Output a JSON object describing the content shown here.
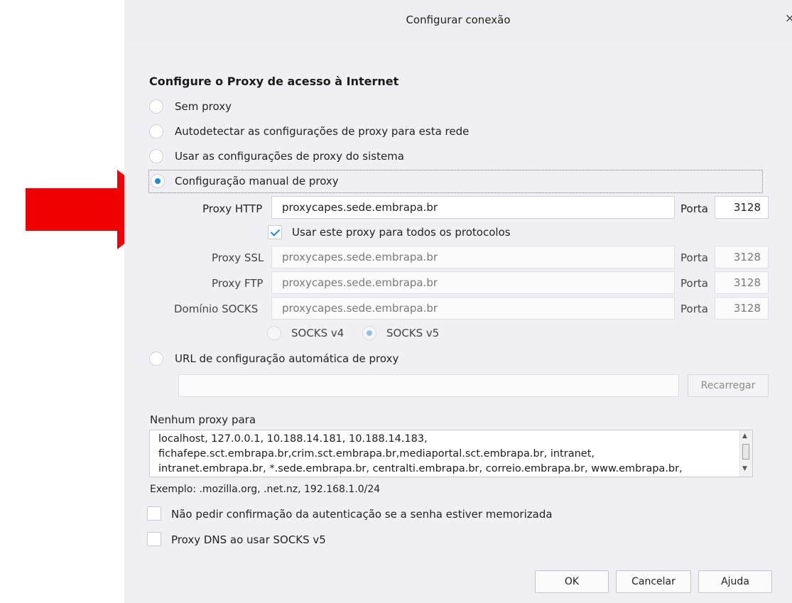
{
  "dialog": {
    "title": "Configurar conexão",
    "close_glyph": "×",
    "heading": "Configure o Proxy de acesso à Internet",
    "options": {
      "no_proxy": "Sem proxy",
      "auto_detect": "Autodetectar as configurações de proxy para esta rede",
      "system": "Usar as configurações de proxy do sistema",
      "manual": "Configuração manual de proxy",
      "pac": "URL de configuração automática de proxy"
    },
    "selected_option": "manual",
    "http": {
      "label": "Proxy HTTP",
      "value": "proxycapes.sede.embrapa.br",
      "port_label": "Porta",
      "port": "3128"
    },
    "use_for_all": {
      "label": "Usar este proxy para todos os protocolos",
      "checked": true
    },
    "ssl": {
      "label": "Proxy SSL",
      "value": "proxycapes.sede.embrapa.br",
      "port_label": "Porta",
      "port": "3128"
    },
    "ftp": {
      "label": "Proxy FTP",
      "value": "proxycapes.sede.embrapa.br",
      "port_label": "Porta",
      "port": "3128"
    },
    "socks": {
      "label": "Domínio SOCKS",
      "value": "proxycapes.sede.embrapa.br",
      "port_label": "Porta",
      "port": "3128"
    },
    "socks_v4": "SOCKS v4",
    "socks_v5": "SOCKS v5",
    "socks_selected": "v5",
    "pac_url": {
      "value": "",
      "reload_label": "Recarregar"
    },
    "no_proxy_for": {
      "label": "Nenhum proxy para",
      "lines": [
        "localhost, 127.0.0.1, 10.188.14.181, 10.188.14.183,",
        "fichafepe.sct.embrapa.br,crim.sct.embrapa.br,mediaportal.sct.embrapa.br, intranet,",
        "intranet.embrapa.br, *.sede.embrapa.br, centralti.embrapa.br, correio.embrapa.br, www.embrapa.br,"
      ],
      "example": "Exemplo: .mozilla.org, .net.nz, 192.168.1.0/24"
    },
    "no_auth_prompt": {
      "label": "Não pedir confirmação da autenticação se a senha estiver memorizada",
      "checked": false
    },
    "proxy_dns": {
      "label": "Proxy DNS ao usar SOCKS v5",
      "checked": false
    },
    "buttons": {
      "ok": "OK",
      "cancel": "Cancelar",
      "help": "Ajuda"
    }
  },
  "annotation": {
    "arrow_color": "#f00000"
  },
  "colors": {
    "accent": "#1a8ad9",
    "dialog_bg": "#f0f0f4"
  }
}
